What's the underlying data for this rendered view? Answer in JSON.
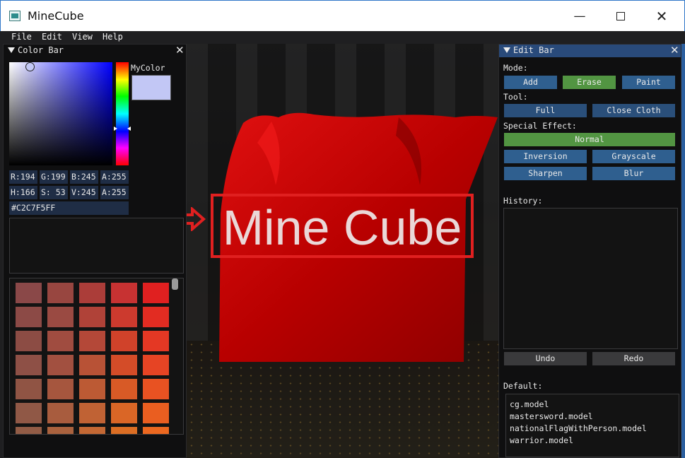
{
  "window": {
    "title": "MineCube",
    "minimize_icon": "—",
    "close_icon": "✕"
  },
  "menu": [
    "File",
    "Edit",
    "View",
    "Help"
  ],
  "color_bar": {
    "title": "Color Bar",
    "mycolor_label": "MyColor",
    "selected_color": "#c2c7f5",
    "rgba": [
      {
        "label": "R:194"
      },
      {
        "label": "G:199"
      },
      {
        "label": "B:245"
      },
      {
        "label": "A:255"
      }
    ],
    "hsva": [
      {
        "label": "H:166"
      },
      {
        "label": "S: 53"
      },
      {
        "label": "V:245"
      },
      {
        "label": "A:255"
      }
    ],
    "hex": "#C2C7F5FF",
    "palette": [
      [
        "#8a4848",
        "#984640",
        "#ab3d39",
        "#c73232",
        "#e02020"
      ],
      [
        "#8c4a46",
        "#9a4a42",
        "#b04238",
        "#cc3a2e",
        "#e22c22"
      ],
      [
        "#8c4c44",
        "#a04c40",
        "#b44838",
        "#d0422a",
        "#e43824"
      ],
      [
        "#8e5046",
        "#a25040",
        "#b85236",
        "#d44c28",
        "#e64424"
      ],
      [
        "#905444",
        "#a6563e",
        "#bc5a34",
        "#d85a26",
        "#e85222"
      ],
      [
        "#905846",
        "#a85c3e",
        "#c06234",
        "#da6626",
        "#ea5e20"
      ],
      [
        "#925c46",
        "#aa623e",
        "#c46834",
        "#dc6e24",
        "#ec6820"
      ]
    ]
  },
  "viewport": {
    "banner_text": "Mine Cube",
    "cloth_color": "#c00000"
  },
  "edit_bar": {
    "title": "Edit Bar",
    "mode_label": "Mode:",
    "modes": [
      {
        "label": "Add",
        "active": false
      },
      {
        "label": "Erase",
        "active": true
      },
      {
        "label": "Paint",
        "active": false
      }
    ],
    "tool_label": "Tool:",
    "tools": [
      {
        "label": "Full"
      },
      {
        "label": "Close Cloth"
      }
    ],
    "effect_label": "Special Effect:",
    "effect_normal": "Normal",
    "effects": [
      {
        "label": "Inversion"
      },
      {
        "label": "Grayscale"
      },
      {
        "label": "Sharpen"
      },
      {
        "label": "Blur"
      }
    ],
    "history_label": "History:",
    "undo_label": "Undo",
    "redo_label": "Redo",
    "default_label": "Default:",
    "default_models": [
      "cg.model",
      "mastersword.model",
      "nationalFlagWithPerson.model",
      "warrior.model"
    ]
  }
}
